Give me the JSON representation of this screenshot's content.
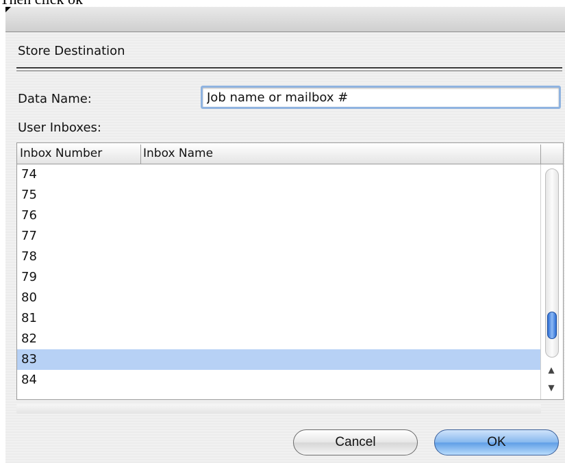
{
  "caption": "Then click ok",
  "dialog": {
    "section_title": "Store Destination",
    "data_name_label": "Data Name:",
    "data_name_value": "Job name or mailbox #",
    "user_inboxes_label": "User Inboxes:",
    "table": {
      "columns": [
        "Inbox Number",
        "Inbox Name"
      ],
      "rows": [
        {
          "number": "74",
          "name": ""
        },
        {
          "number": "75",
          "name": ""
        },
        {
          "number": "76",
          "name": ""
        },
        {
          "number": "77",
          "name": ""
        },
        {
          "number": "78",
          "name": ""
        },
        {
          "number": "79",
          "name": ""
        },
        {
          "number": "80",
          "name": ""
        },
        {
          "number": "81",
          "name": ""
        },
        {
          "number": "82",
          "name": ""
        },
        {
          "number": "83",
          "name": "",
          "selected": true
        },
        {
          "number": "84",
          "name": ""
        }
      ]
    },
    "scrollbar": {
      "up_arrow": "▲",
      "down_arrow": "▼"
    },
    "buttons": {
      "cancel": "Cancel",
      "ok": "OK"
    }
  }
}
